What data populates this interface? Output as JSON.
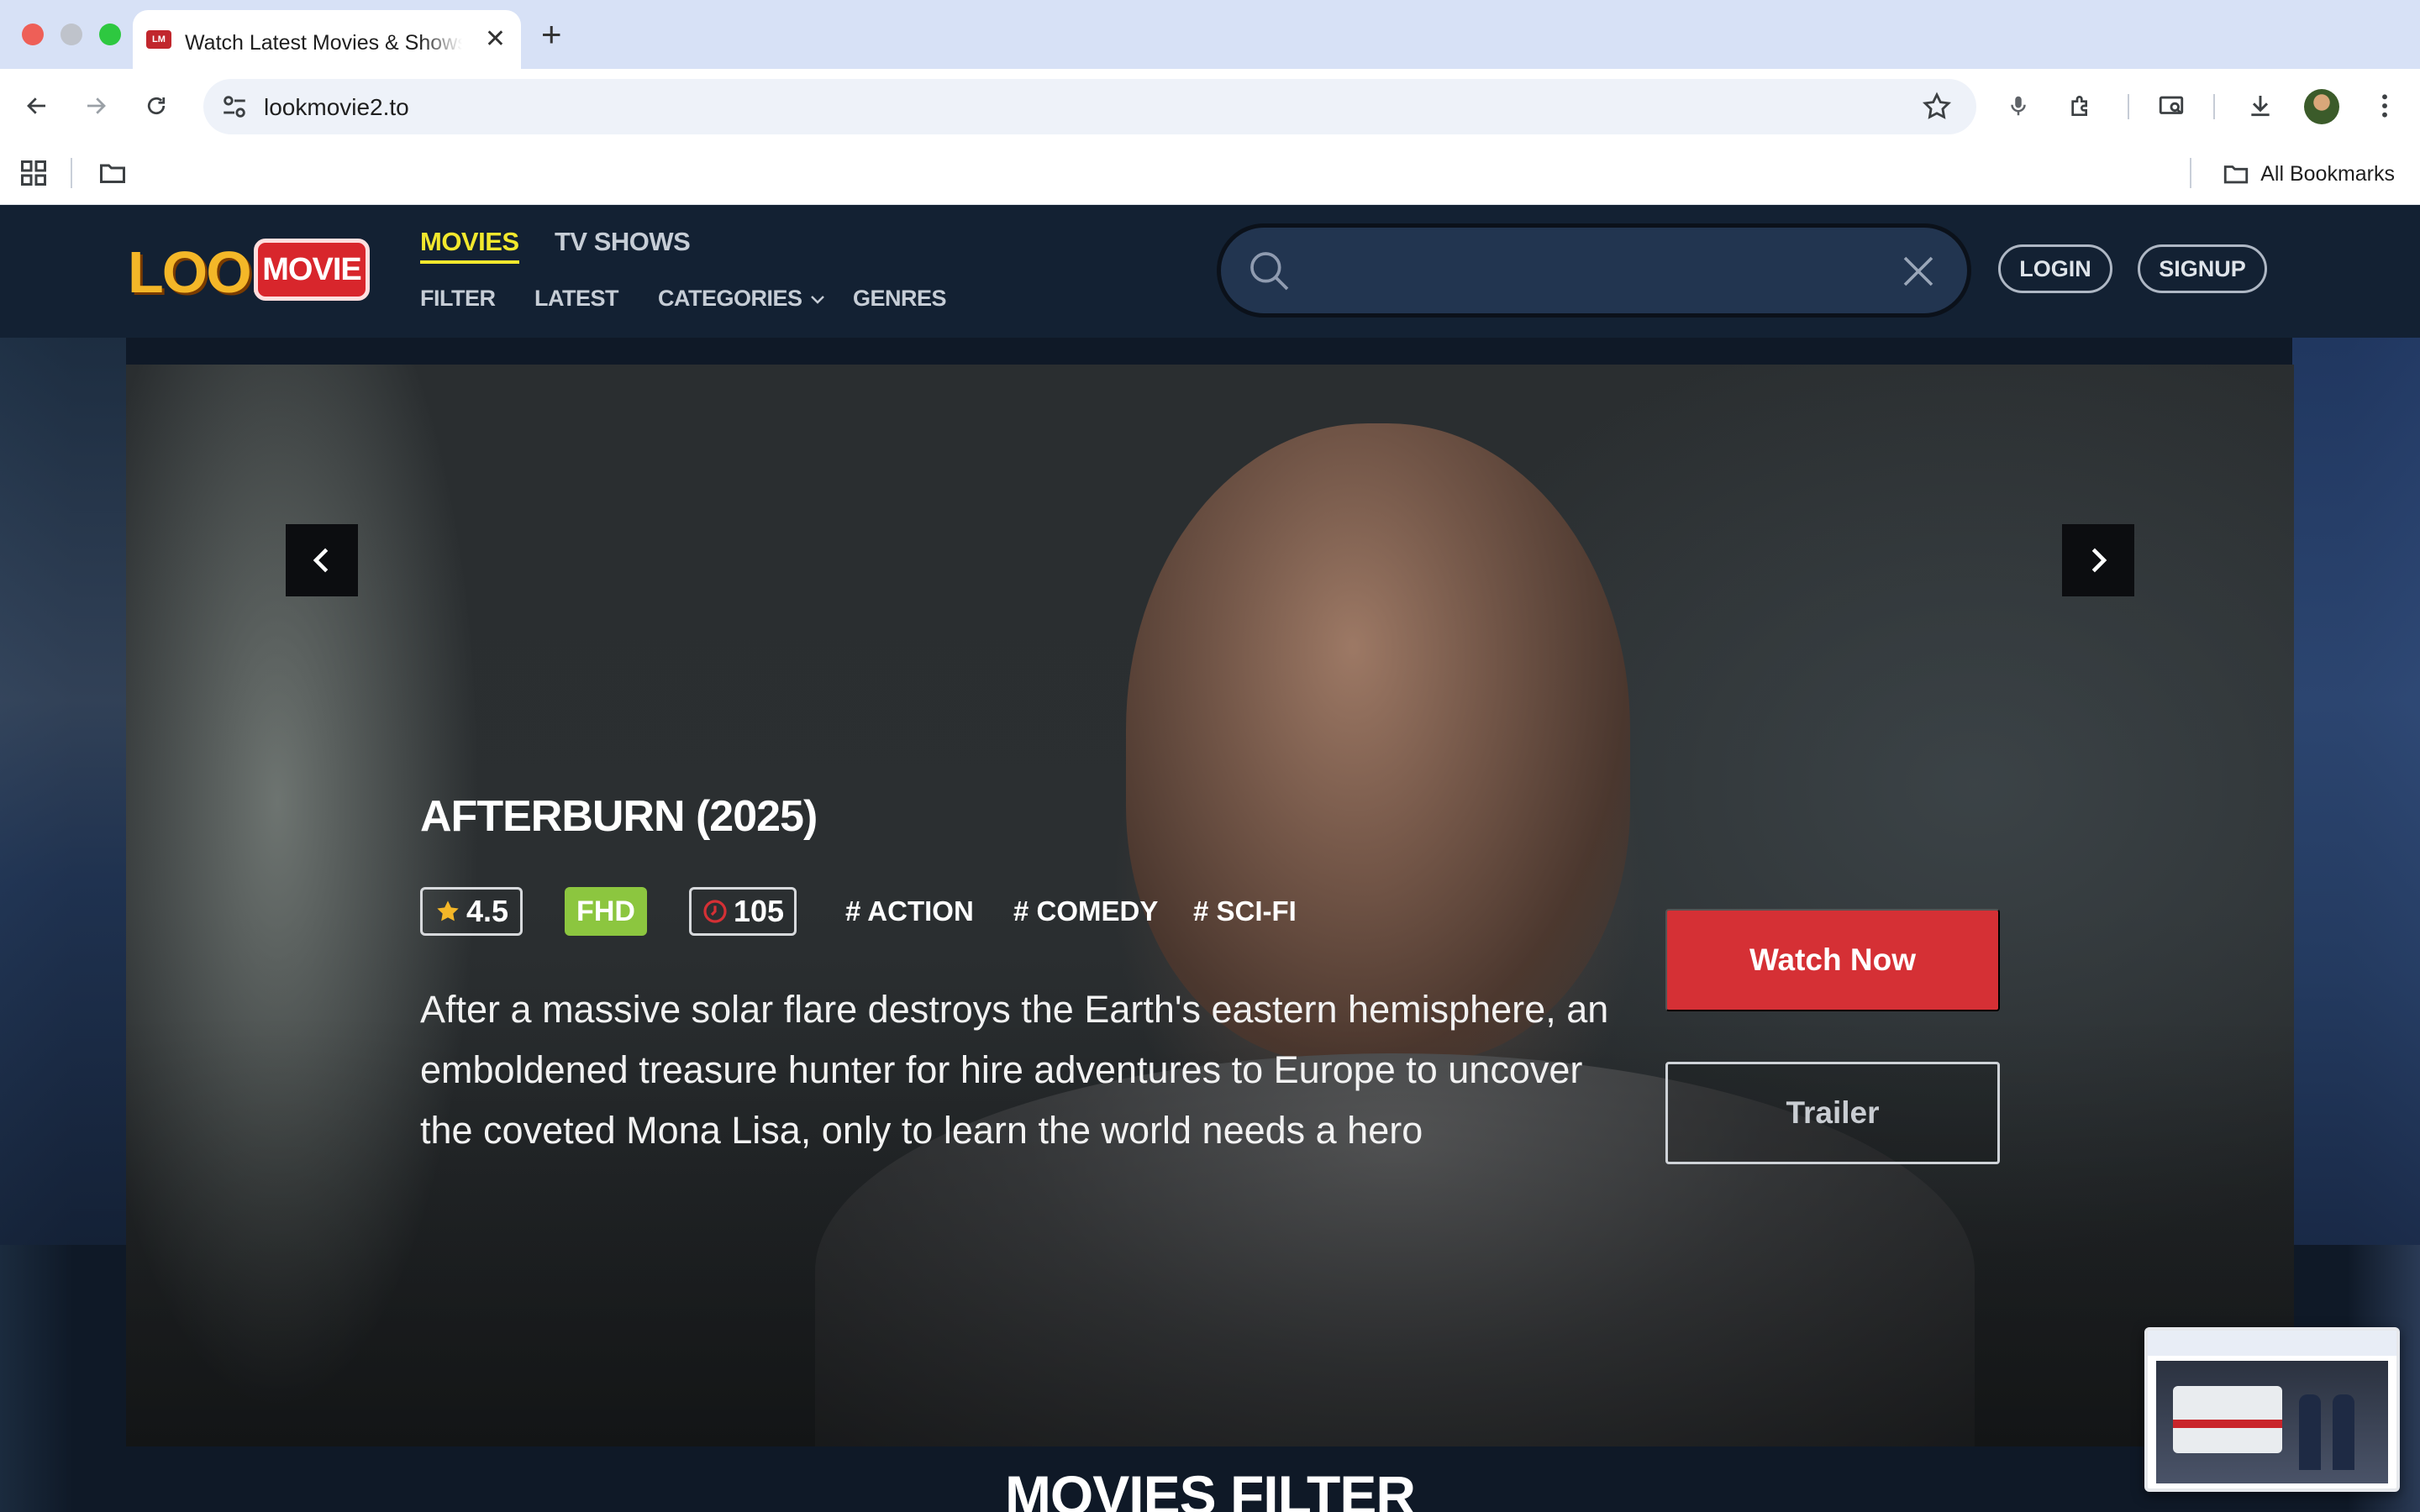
{
  "browser": {
    "tab_title": "Watch Latest Movies & Shows",
    "tab_favicon_text": "LM",
    "url": "lookmovie2.to",
    "bookmarks_label": "All Bookmarks"
  },
  "site": {
    "logo_look": "LOOK",
    "logo_movie": "MOVIE",
    "nav_main": [
      "MOVIES",
      "TV SHOWS"
    ],
    "nav_sub": [
      "FILTER",
      "LATEST",
      "CATEGORIES",
      "GENRES"
    ],
    "search_value": "",
    "login_label": "LOGIN",
    "signup_label": "SIGNUP"
  },
  "hero": {
    "title": "AFTERBURN (2025)",
    "rating": "4.5",
    "quality": "FHD",
    "runtime": "105",
    "tags": [
      "# ACTION",
      "# COMEDY",
      "# SCI-FI"
    ],
    "description": "After a massive solar flare destroys the Earth's eastern hemisphere, an emboldened treasure hunter for hire adventures to Europe to uncover the coveted Mona Lisa, only to learn the world needs a hero",
    "watch_label": "Watch Now",
    "trailer_label": "Trailer"
  },
  "section": {
    "title": "MOVIES FILTER"
  },
  "colors": {
    "header_bg": "#132133",
    "accent_yellow": "#f2e82d",
    "watch_red": "#d53035",
    "fhd_green": "#8cc63f"
  }
}
